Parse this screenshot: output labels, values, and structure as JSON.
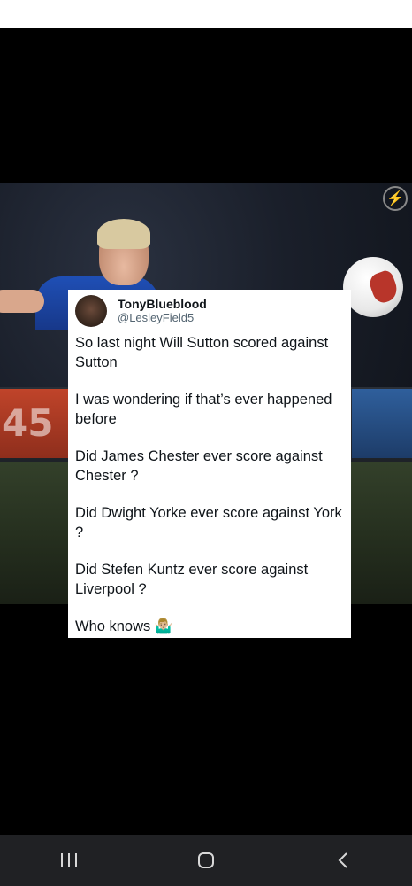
{
  "tweet": {
    "display_name": "TonyBlueblood",
    "handle": "@LesleyField5",
    "paragraphs": [
      "So last night Will Sutton scored against Sutton",
      "I was wondering if that’s ever happened before",
      "Did James Chester ever score against Chester ?",
      "Did Dwight Yorke ever score against York ?",
      "Did Stefen Kuntz ever score against Liverpool ?",
      "Who knows 🤷🏼‍♂️"
    ]
  },
  "photo": {
    "ad_text": "45"
  },
  "navbar": {
    "items": [
      "recents-icon",
      "home-icon",
      "back-icon"
    ]
  }
}
